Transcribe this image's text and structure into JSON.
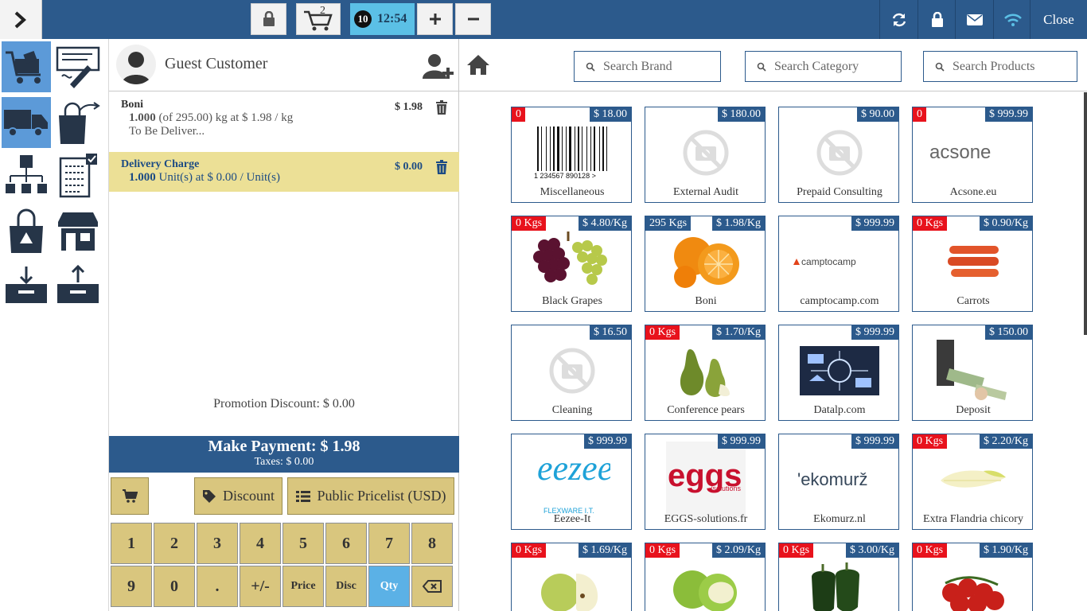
{
  "topbar": {
    "cart_count": "2",
    "order_badge": "10",
    "clock": "12:54",
    "close_label": "Close"
  },
  "customer": {
    "name": "Guest Customer"
  },
  "orderlines": [
    {
      "name": "Boni",
      "price": "$ 1.98",
      "qty": "1.000",
      "detail": "(of 295.00) kg at $ 1.98 / kg",
      "note": "To Be Deliver..."
    },
    {
      "name": "Delivery Charge",
      "price": "$ 0.00",
      "qty": "1.000",
      "detail": "Unit(s) at $ 0.00 / Unit(s)"
    }
  ],
  "summary": {
    "promotion": "Promotion Discount: $ 0.00",
    "payment": "Make Payment: $ 1.98",
    "taxes": "Taxes: $ 0.00"
  },
  "actions": {
    "discount": "Discount",
    "pricelist": "Public Pricelist (USD)"
  },
  "numpad": [
    "1",
    "2",
    "3",
    "4",
    "5",
    "6",
    "7",
    "8",
    "9",
    "0",
    ".",
    "+/-",
    "Price",
    "Disc",
    "Qty"
  ],
  "search": {
    "brand": "Search Brand",
    "category": "Search Category",
    "products": "Search Products"
  },
  "products": [
    {
      "name": "Miscellaneous",
      "price": "$ 18.00",
      "stock": "0",
      "icon": "barcode"
    },
    {
      "name": "External Audit",
      "price": "$ 180.00",
      "stock": "",
      "icon": "no-image"
    },
    {
      "name": "Prepaid Consulting",
      "price": "$ 90.00",
      "stock": "",
      "icon": "no-image"
    },
    {
      "name": "Acsone.eu",
      "price": "$ 999.99",
      "stock": "0",
      "icon": "acsone-logo"
    },
    {
      "name": "Black Grapes",
      "price": "$ 4.80/Kg",
      "stock": "0 Kgs",
      "icon": "grapes"
    },
    {
      "name": "Boni",
      "price": "$ 1.98/Kg",
      "stock": "295 Kgs",
      "icon": "oranges"
    },
    {
      "name": "camptocamp.com",
      "price": "$ 999.99",
      "stock": "",
      "icon": "camptocamp-logo"
    },
    {
      "name": "Carrots",
      "price": "$ 0.90/Kg",
      "stock": "0 Kgs",
      "icon": "carrots"
    },
    {
      "name": "Cleaning",
      "price": "$ 16.50",
      "stock": "",
      "icon": "no-image"
    },
    {
      "name": "Conference pears",
      "price": "$ 1.70/Kg",
      "stock": "0 Kgs",
      "icon": "pears"
    },
    {
      "name": "Datalp.com",
      "price": "$ 999.99",
      "stock": "",
      "icon": "datalp-image"
    },
    {
      "name": "Deposit",
      "price": "$ 150.00",
      "stock": "",
      "icon": "money"
    },
    {
      "name": "Eezee-It",
      "price": "$ 999.99",
      "stock": "",
      "icon": "eezee-logo"
    },
    {
      "name": "EGGS-solutions.fr",
      "price": "$ 999.99",
      "stock": "",
      "icon": "eggs-logo"
    },
    {
      "name": "Ekomurz.nl",
      "price": "$ 999.99",
      "stock": "",
      "icon": "ekomurz-logo"
    },
    {
      "name": "Extra Flandria chicory",
      "price": "$ 2.20/Kg",
      "stock": "0 Kgs",
      "icon": "chicory"
    },
    {
      "name": "",
      "price": "$ 1.69/Kg",
      "stock": "0 Kgs",
      "icon": "apples"
    },
    {
      "name": "",
      "price": "$ 2.09/Kg",
      "stock": "0 Kgs",
      "icon": "green-apples"
    },
    {
      "name": "",
      "price": "$ 3.00/Kg",
      "stock": "0 Kgs",
      "icon": "green-peppers"
    },
    {
      "name": "",
      "price": "$ 1.90/Kg",
      "stock": "0 Kgs",
      "icon": "tomatoes"
    }
  ],
  "logos": {
    "acsone": "acsone",
    "camptocamp": "camptocamp",
    "eezee": "eezee",
    "eezee_sub": "FLEXWARE I.T.",
    "eggs": "eggs",
    "eggs_sub": "/solutions",
    "ekomurz": "'ekomurž",
    "barcode_digits": "1 234567 890128 >"
  },
  "colors": {
    "primary": "#2c5a8c",
    "accent": "#5bc0e6",
    "button": "#d9c67e",
    "selected_line": "#ece096",
    "stock_badge": "#e8121c"
  }
}
